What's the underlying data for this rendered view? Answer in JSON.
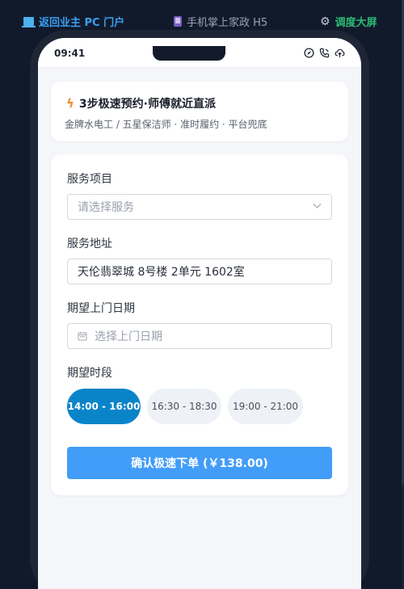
{
  "topnav": {
    "pc_portal": "返回业主 PC 门户",
    "h5": "手机掌上家政 H5",
    "dispatch": "调度大屏"
  },
  "status": {
    "time": "09:41",
    "icons": [
      "compass-icon",
      "phone-icon",
      "cloud-upload-icon"
    ]
  },
  "promo": {
    "icon": "lightning-icon",
    "title": "3步极速预约·师傅就近直派",
    "subtitle": "金牌水电工 / 五星保洁师 · 准时履约 · 平台兜底"
  },
  "form": {
    "service_label": "服务项目",
    "service_placeholder": "请选择服务",
    "address_label": "服务地址",
    "address_value": "天伦翡翠城 8号楼 2单元 1602室",
    "date_label": "期望上门日期",
    "date_placeholder": "选择上门日期",
    "time_label": "期望时段",
    "slots": [
      {
        "label": "14:00 - 16:00",
        "selected": true
      },
      {
        "label": "16:30 - 18:30",
        "selected": false
      },
      {
        "label": "19:00 - 21:00",
        "selected": false
      }
    ],
    "submit_label": "确认极速下单 (￥138.00)"
  },
  "colors": {
    "accent": "#429df8",
    "selected_slot": "#0a84c9",
    "nav_pc": "#3aa0f2",
    "nav_dispatch": "#2dbb74",
    "background": "#111a2b"
  }
}
